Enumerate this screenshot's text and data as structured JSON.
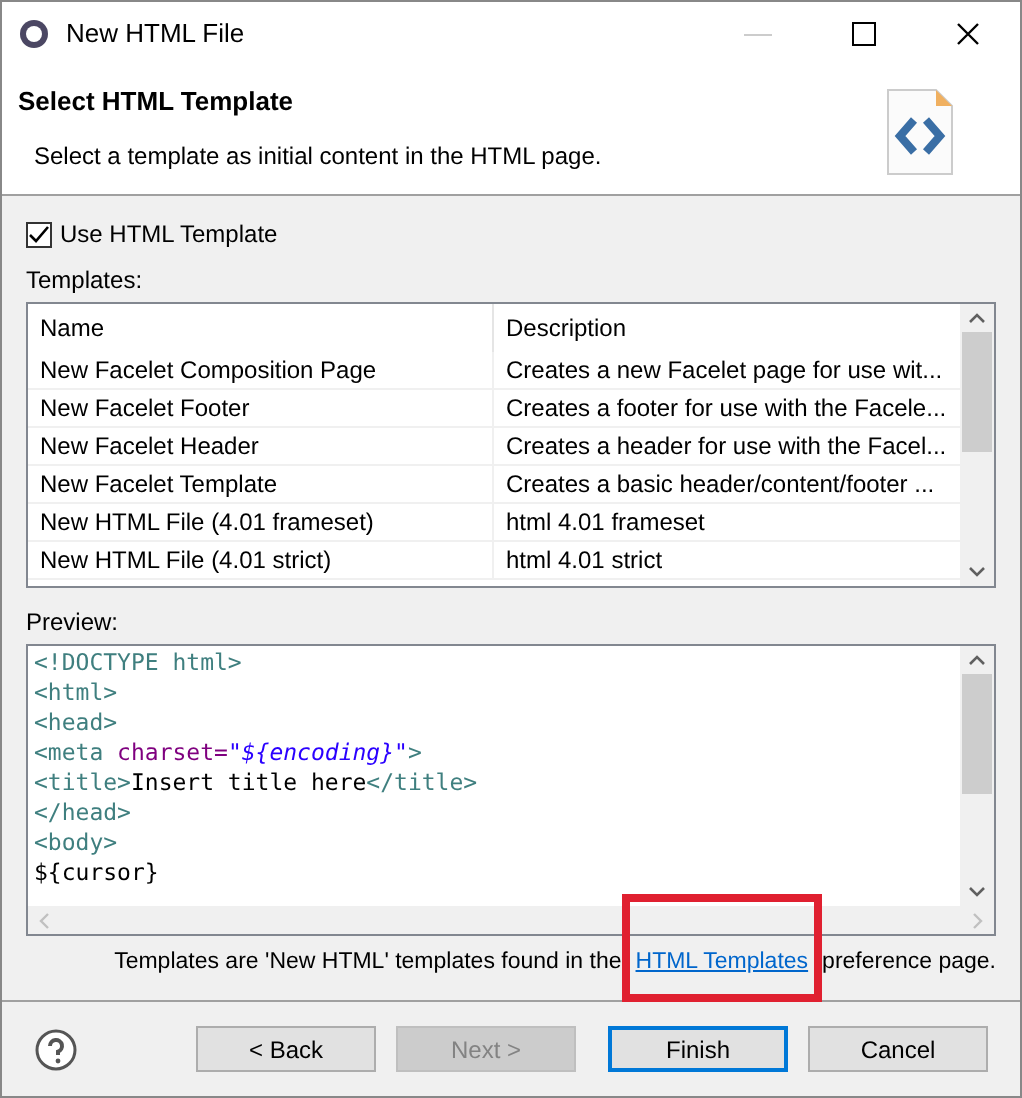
{
  "window": {
    "title": "New HTML File"
  },
  "header": {
    "title": "Select HTML Template",
    "description": "Select a template as initial content in the HTML page."
  },
  "use_template": {
    "label": "Use HTML Template",
    "checked": true
  },
  "templates": {
    "label": "Templates:",
    "columns": [
      "Name",
      "Description"
    ],
    "rows": [
      {
        "name": "New Facelet Composition Page",
        "description": "Creates a new Facelet page for use wit...",
        "selected": false
      },
      {
        "name": "New Facelet Footer",
        "description": "Creates a footer for use with the Facele...",
        "selected": false
      },
      {
        "name": "New Facelet Header",
        "description": "Creates a header for use with the Facel...",
        "selected": false
      },
      {
        "name": "New Facelet Template",
        "description": "Creates a basic header/content/footer ...",
        "selected": false
      },
      {
        "name": "New HTML File (4.01 frameset)",
        "description": "html 4.01 frameset",
        "selected": false
      },
      {
        "name": "New HTML File (4.01 strict)",
        "description": "html 4.01 strict",
        "selected": false
      }
    ]
  },
  "preview": {
    "label": "Preview:",
    "lines": [
      [
        {
          "kind": "tag",
          "text": "<!DOCTYPE html>"
        }
      ],
      [
        {
          "kind": "tag",
          "text": "<html>"
        }
      ],
      [
        {
          "kind": "tag",
          "text": "<head>"
        }
      ],
      [
        {
          "kind": "tag",
          "text": "<meta "
        },
        {
          "kind": "attr",
          "text": "charset="
        },
        {
          "kind": "string",
          "text": "\"${encoding}\""
        },
        {
          "kind": "tag",
          "text": ">"
        }
      ],
      [
        {
          "kind": "tag",
          "text": "<title>"
        },
        {
          "kind": "text",
          "text": "Insert title here"
        },
        {
          "kind": "tag",
          "text": "</title>"
        }
      ],
      [
        {
          "kind": "tag",
          "text": "</head>"
        }
      ],
      [
        {
          "kind": "tag",
          "text": "<body>"
        }
      ],
      [
        {
          "kind": "text",
          "text": "${cursor}"
        }
      ]
    ]
  },
  "footer_note": {
    "before": "Templates are 'New HTML' templates found in the",
    "link": "HTML Templates",
    "after": "preference page."
  },
  "buttons": [
    {
      "label": "< Back",
      "disabled": false,
      "default": false
    },
    {
      "label": "Next >",
      "disabled": true,
      "default": false
    },
    {
      "label": "Finish",
      "disabled": false,
      "default": true
    },
    {
      "label": "Cancel",
      "disabled": false,
      "default": false
    }
  ]
}
